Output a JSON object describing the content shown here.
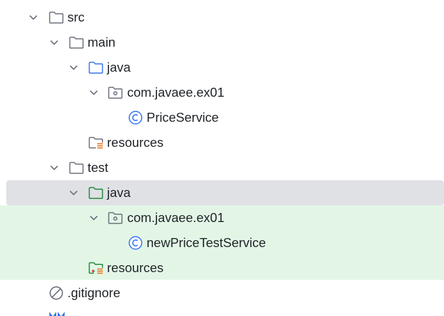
{
  "tree": {
    "src": {
      "label": "src"
    },
    "main": {
      "label": "main"
    },
    "main_java": {
      "label": "java"
    },
    "main_package": {
      "label": "com.javaee.ex01"
    },
    "price_service": {
      "label": "PriceService"
    },
    "main_resources": {
      "label": "resources"
    },
    "test": {
      "label": "test"
    },
    "test_java": {
      "label": "java"
    },
    "test_package": {
      "label": "com.javaee.ex01"
    },
    "new_price_test_service": {
      "label": "newPriceTestService"
    },
    "test_resources": {
      "label": "resources"
    },
    "gitignore": {
      "label": ".gitignore"
    }
  },
  "icons": {
    "folder": "folder-icon",
    "source_folder": "source-folder-icon",
    "test_folder": "test-source-folder-icon",
    "package": "package-icon",
    "class": "java-class-icon",
    "resources": "resources-folder-icon",
    "test_resources": "test-resources-folder-icon",
    "ignore": "gitignore-icon",
    "maven": "maven-icon"
  },
  "colors": {
    "selection": "#dfe1e5",
    "test_highlight": "#e3f6e6",
    "source_blue": "#3574f0",
    "test_green": "#208a3c",
    "icon_gray": "#6c707e",
    "resources_orange": "#e66d17"
  }
}
